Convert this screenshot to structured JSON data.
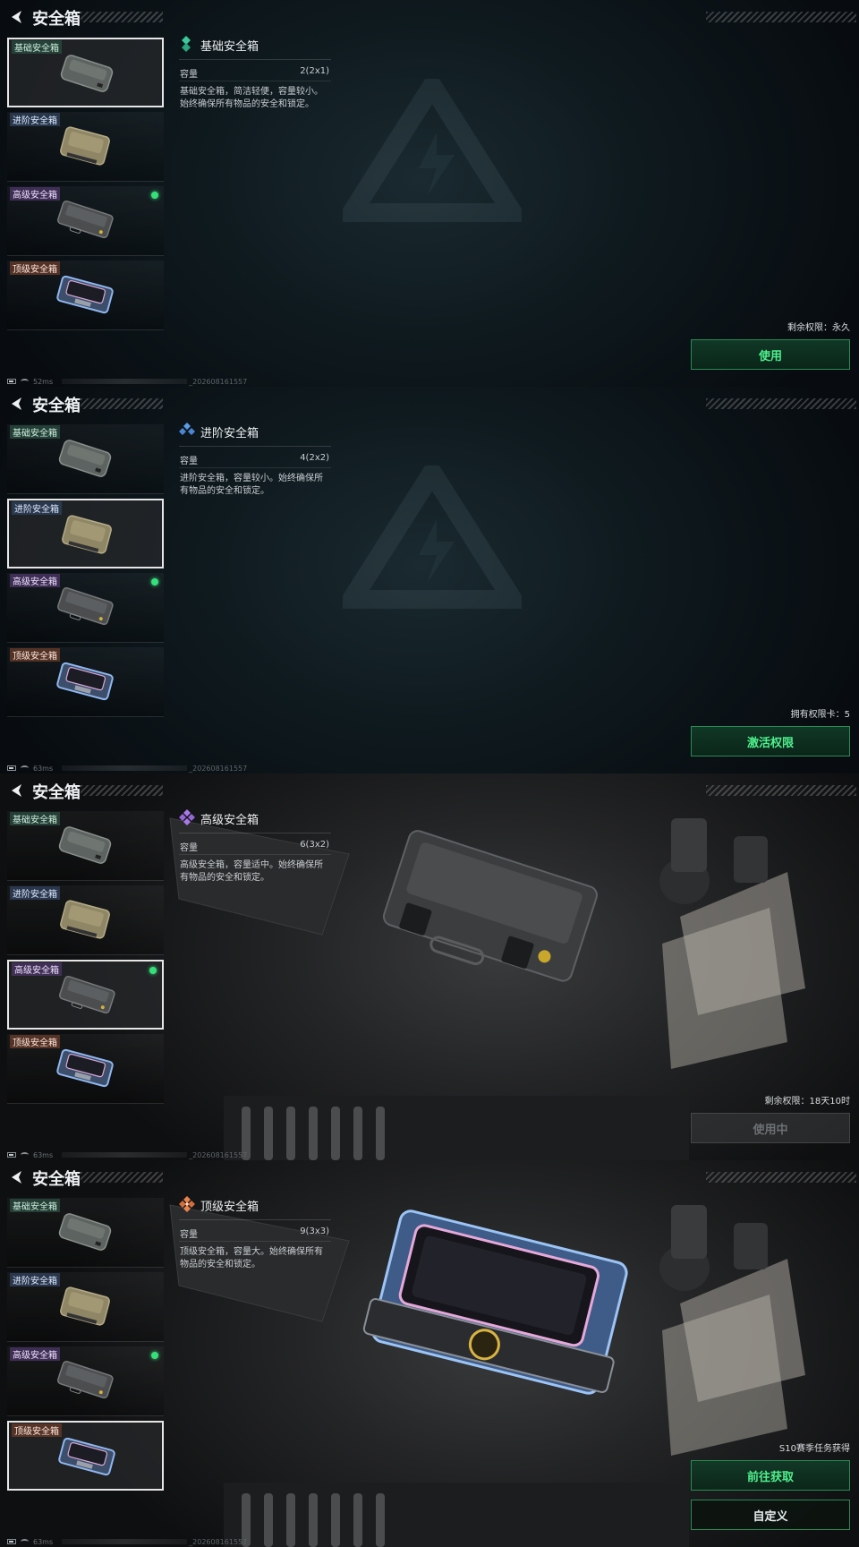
{
  "title": "安全箱",
  "list_labels": [
    "基础安全箱",
    "进阶安全箱",
    "高级安全箱",
    "顶级安全箱"
  ],
  "equipped_index": 2,
  "rarity_colors": {
    "basic": "#3cc89a",
    "advanced": "#5b9be8",
    "superior": "#a77ae8",
    "top": "#e8844f"
  },
  "capacity_label": "容量",
  "panels": [
    {
      "selected_index": 0,
      "rarity_icon": "green-diamond-icon",
      "name": "基础安全箱",
      "capacity": "2(2x1)",
      "description": "基础安全箱，简洁轻便，容量较小。始终确保所有物品的安全和锁定。",
      "status": "剩余权限：永久",
      "primary_button": "使用",
      "footer": {
        "ping": "52ms",
        "uid": "_202608161557"
      }
    },
    {
      "selected_index": 1,
      "rarity_icon": "blue-diamond-icon",
      "name": "进阶安全箱",
      "capacity": "4(2x2)",
      "description": "进阶安全箱，容量较小。始终确保所有物品的安全和锁定。",
      "status": "拥有权限卡：5",
      "primary_button": "激活权限",
      "footer": {
        "ping": "63ms",
        "uid": "_202608161557"
      }
    },
    {
      "selected_index": 2,
      "rarity_icon": "purple-diamond-icon",
      "name": "高级安全箱",
      "capacity": "6(3x2)",
      "description": "高级安全箱，容量适中。始终确保所有物品的安全和锁定。",
      "status": "剩余权限：18天10时",
      "primary_button": "使用中",
      "footer": {
        "ping": "63ms",
        "uid": "_202608161557"
      }
    },
    {
      "selected_index": 3,
      "rarity_icon": "orange-diamond-icon",
      "name": "顶级安全箱",
      "capacity": "9(3x3)",
      "description": "顶级安全箱，容量大。始终确保所有物品的安全和锁定。",
      "status": "S10赛季任务获得",
      "secondary_button": "前往获取",
      "primary_button": "自定义",
      "footer": {
        "ping": "63ms",
        "uid": "_202608161557"
      }
    }
  ]
}
